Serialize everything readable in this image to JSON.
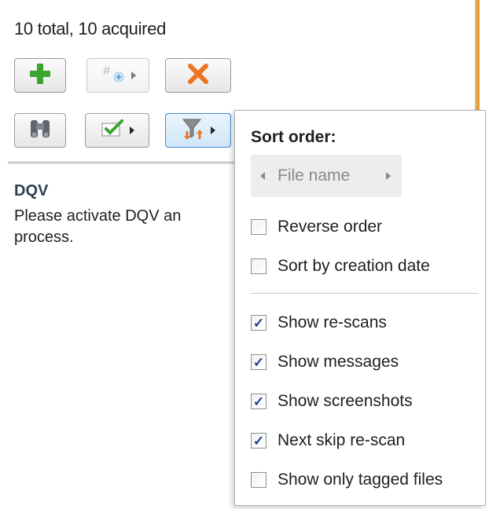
{
  "status": {
    "text": "10 total, 10 acquired"
  },
  "toolbar": {
    "row1": [
      {
        "name": "add-button",
        "icon": "plus-icon"
      },
      {
        "name": "add-counter-button",
        "icon": "number-add-icon"
      },
      {
        "name": "delete-button",
        "icon": "x-icon"
      }
    ],
    "row2": [
      {
        "name": "binoculars-button",
        "icon": "binoculars-icon"
      },
      {
        "name": "check-menu-button",
        "icon": "checkmark-icon"
      },
      {
        "name": "filter-menu-button",
        "icon": "filter-sort-icon"
      }
    ]
  },
  "dqv": {
    "title": "DQV",
    "message": "Please activate DQV an\nprocess."
  },
  "menu": {
    "sort_title": "Sort order:",
    "sort_value": "File name",
    "options_group1": [
      {
        "label": "Reverse order",
        "checked": false
      },
      {
        "label": "Sort by creation date",
        "checked": false
      }
    ],
    "options_group2": [
      {
        "label": "Show re-scans",
        "checked": true
      },
      {
        "label": "Show messages",
        "checked": true
      },
      {
        "label": "Show screenshots",
        "checked": true
      },
      {
        "label": "Next skip re-scan",
        "checked": true
      },
      {
        "label": "Show only tagged files",
        "checked": false
      }
    ]
  },
  "colors": {
    "accent_orange": "#f0a020",
    "plus_green": "#3aa52c",
    "delete_orange": "#ee7421",
    "check_blue": "#1e3f8f"
  }
}
